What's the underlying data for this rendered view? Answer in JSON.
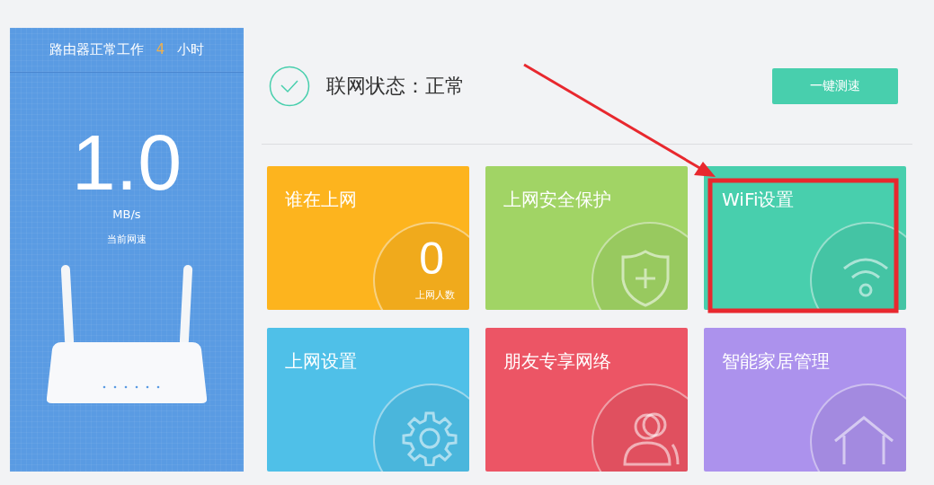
{
  "uptime": {
    "prefix": "路由器正常工作",
    "hours": "4",
    "suffix": "小时"
  },
  "speed": {
    "value": "1.0",
    "unit": "MB/s",
    "label": "当前网速"
  },
  "status": {
    "label": "联网状态：正常"
  },
  "speed_test_button": "一键测速",
  "tiles": [
    {
      "title": "谁在上网",
      "kind": "count",
      "color": "#fdb41e",
      "count": "0",
      "count_label": "上网人数"
    },
    {
      "title": "上网安全保护",
      "kind": "shield",
      "color": "#a1d465"
    },
    {
      "title": "WiFi设置",
      "kind": "wifi",
      "color": "#48cfad"
    },
    {
      "title": "上网设置",
      "kind": "gear",
      "color": "#4fc0e8"
    },
    {
      "title": "朋友专享网络",
      "kind": "people",
      "color": "#ec5565"
    },
    {
      "title": "智能家居管理",
      "kind": "house",
      "color": "#ac92ed"
    }
  ]
}
